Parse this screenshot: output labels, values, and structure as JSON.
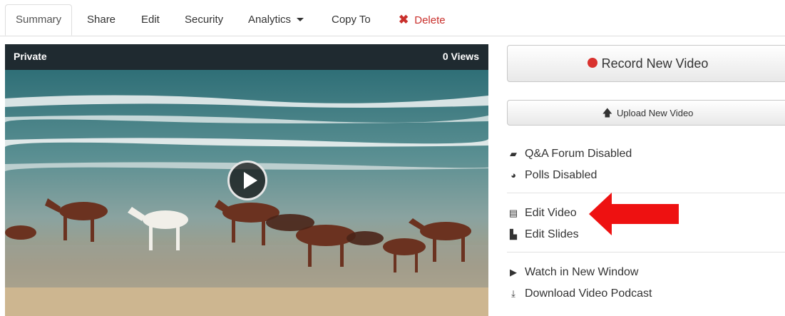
{
  "tabs": {
    "summary": "Summary",
    "share": "Share",
    "edit": "Edit",
    "security": "Security",
    "analytics": "Analytics",
    "copy_to": "Copy To",
    "delete": "Delete"
  },
  "video": {
    "visibility": "Private",
    "views": "0 Views"
  },
  "actions": {
    "record": "Record New Video",
    "upload": "Upload New Video"
  },
  "links": {
    "qa": "Q&A Forum Disabled",
    "polls": "Polls Disabled",
    "edit_video": "Edit Video",
    "edit_slides": "Edit Slides",
    "watch": "Watch in New Window",
    "download": "Download Video Podcast"
  },
  "colors": {
    "delete_red": "#c9302c",
    "record_dot": "#d9322e",
    "arrow_red": "#ee1111",
    "video_header": "#1f2a30"
  }
}
